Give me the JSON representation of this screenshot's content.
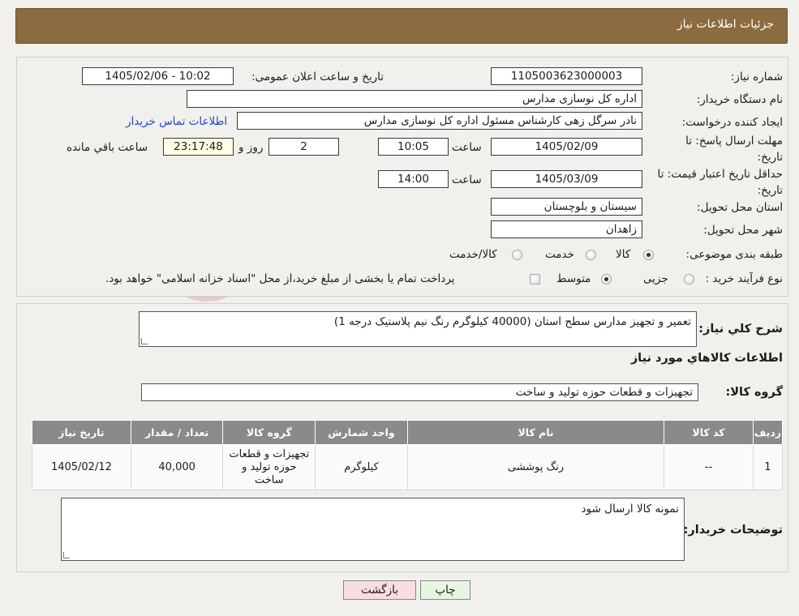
{
  "header": {
    "title": "جزئیات اطلاعات نیاز"
  },
  "form": {
    "need_number_label": "شماره نیاز:",
    "need_number": "1105003623000003",
    "announce_label": "تاریخ و ساعت اعلان عمومی:",
    "announce_value": "1405/02/06 - 10:02",
    "buyer_org_label": "نام دستگاه خریدار:",
    "buyer_org": "اداره کل نوسازی مدارس",
    "requester_label": "ایجاد کننده درخواست:",
    "requester": "نادر سرگل زهی کارشناس مسئول اداره کل نوسازی مدارس",
    "contact_link": "اطلاعات تماس خریدار",
    "deadline_label": "مهلت ارسال پاسخ: تا تاریخ:",
    "deadline_date": "1405/02/09",
    "time_label": "ساعت",
    "deadline_time": "10:05",
    "days_value": "2",
    "days_label": "روز و",
    "remaining_time": "23:17:48",
    "remaining_label": "ساعت باقي مانده",
    "validity_label": "حداقل تاریخ اعتبار قیمت: تا تاریخ:",
    "validity_date": "1405/03/09",
    "validity_time": "14:00",
    "province_label": "استان محل تحویل:",
    "province": "سیستان و بلوچستان",
    "city_label": "شهر محل تحویل:",
    "city": "زاهدان",
    "category_label": "طبقه بندی موضوعی:",
    "category_options": [
      "کالا",
      "خدمت",
      "کالا/خدمت"
    ],
    "process_label": "نوع فرآیند خرید :",
    "process_options": [
      "جزیی",
      "متوسط"
    ],
    "process_note": "پرداخت تمام یا بخشی از مبلغ خرید،از محل \"اسناد خزانه اسلامی\" خواهد بود."
  },
  "summary": {
    "description_label": "شرح کلي نياز:",
    "description": "تعمیر و تجهیز مدارس سطح استان (40000 کیلوگرم رنگ نیم پلاستیک درجه 1)",
    "items_title": "اطلاعات کالاهاي مورد نياز",
    "group_label": "گروه کالا:",
    "group_value": "تجهیزات و قطعات حوزه تولید و ساخت",
    "table": {
      "headers": [
        "رديف",
        "کد کالا",
        "نام کالا",
        "واحد شمارش",
        "گروه کالا",
        "تعداد / مقدار",
        "تاريخ نياز"
      ],
      "rows": [
        [
          "1",
          "--",
          "رنگ پوششی",
          "کیلوگرم",
          "تجهیزات و قطعات حوزه تولید و ساخت",
          "40,000",
          "1405/02/12"
        ]
      ]
    },
    "buyer_notes_label": "توضیحات خریدار:",
    "buyer_notes": "نمونه کالا ارسال شود"
  },
  "buttons": {
    "print": "چاپ",
    "back": "بازگشت"
  },
  "colors": {
    "header": "#8b6b3f",
    "table_header": "#8a8a8a",
    "back_button": "#f9dede",
    "print_button": "#e6f6e0"
  }
}
